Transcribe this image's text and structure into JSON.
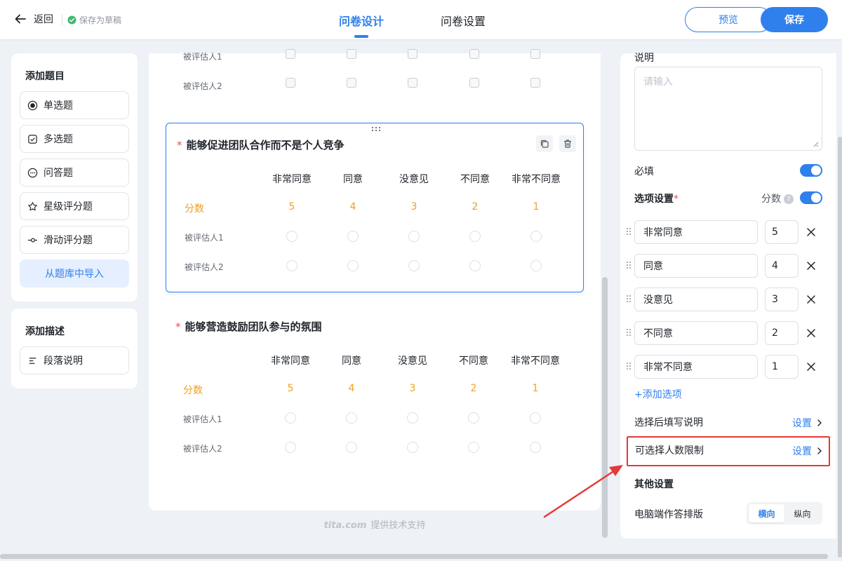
{
  "header": {
    "back_label": "返回",
    "draft_label": "保存为草稿",
    "tab_design": "问卷设计",
    "tab_settings": "问卷设置",
    "preview_label": "预览",
    "save_label": "保存"
  },
  "left": {
    "add_question_title": "添加题目",
    "question_types": [
      "单选题",
      "多选题",
      "问答题",
      "星级评分题",
      "滑动评分题"
    ],
    "import_label": "从题库中导入",
    "add_desc_title": "添加描述",
    "desc_types": [
      "段落说明"
    ]
  },
  "canvas": {
    "prev_rows": [
      "被评估人1",
      "被评估人2"
    ],
    "questions": [
      {
        "title": "能够促进团队合作而不是个人竞争",
        "required_mark": "*",
        "columns": [
          "非常同意",
          "同意",
          "没意见",
          "不同意",
          "非常不同意"
        ],
        "score_label": "分数",
        "scores": [
          "5",
          "4",
          "3",
          "2",
          "1"
        ],
        "rows": [
          "被评估人1",
          "被评估人2"
        ]
      },
      {
        "title": "能够营造鼓励团队参与的氛围",
        "required_mark": "*",
        "columns": [
          "非常同意",
          "同意",
          "没意见",
          "不同意",
          "非常不同意"
        ],
        "score_label": "分数",
        "scores": [
          "5",
          "4",
          "3",
          "2",
          "1"
        ],
        "rows": [
          "被评估人1",
          "被评估人2"
        ]
      }
    ],
    "footer_logo": "tita.com",
    "footer_text": "提供技术支持"
  },
  "right": {
    "desc_label": "说明",
    "desc_placeholder": "请输入",
    "required_label": "必填",
    "options_label": "选项设置",
    "required_star": "*",
    "score_toggle_label": "分数",
    "help_glyph": "?",
    "options": [
      {
        "label": "非常同意",
        "score": "5"
      },
      {
        "label": "同意",
        "score": "4"
      },
      {
        "label": "没意见",
        "score": "3"
      },
      {
        "label": "不同意",
        "score": "2"
      },
      {
        "label": "非常不同意",
        "score": "1"
      }
    ],
    "add_option_label": "+添加选项",
    "fill_after_label": "选择后填写说明",
    "limit_label": "可选择人数限制",
    "set_label": "设置",
    "other_settings_label": "其他设置",
    "layout_label": "电脑端作答排版",
    "layout_options": [
      "横向",
      "纵向"
    ],
    "layout_selected": "横向"
  },
  "colors": {
    "accent": "#2f80ed",
    "score": "#f0a020",
    "required": "#f54a45",
    "highlight": "#e53935"
  }
}
